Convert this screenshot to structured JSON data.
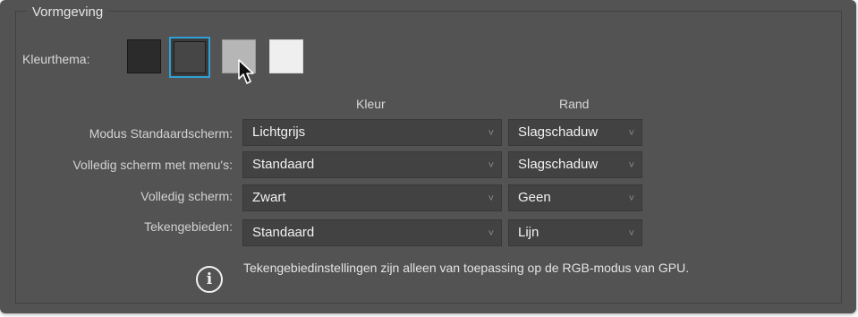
{
  "section": {
    "title": "Vormgeving"
  },
  "theme": {
    "label": "Kleurthema:",
    "swatches": [
      {
        "name": "dark",
        "color": "#2b2b2b"
      },
      {
        "name": "medium-dark",
        "color": "#3b3b3b",
        "selected": true
      },
      {
        "name": "medium-light",
        "color": "#b6b6b6"
      },
      {
        "name": "light",
        "color": "#efefef"
      }
    ],
    "selected_border_color": "#30a1d6"
  },
  "columns": {
    "kleur": "Kleur",
    "rand": "Rand"
  },
  "rows": [
    {
      "label": "Modus Standaardscherm:",
      "kleur": "Lichtgrijs",
      "rand": "Slagschaduw"
    },
    {
      "label": "Volledig scherm met menu's:",
      "kleur": "Standaard",
      "rand": "Slagschaduw"
    },
    {
      "label": "Volledig scherm:",
      "kleur": "Zwart",
      "rand": "Geen"
    },
    {
      "label": "Tekengebieden:",
      "kleur": "Standaard",
      "rand": "Lijn"
    }
  ],
  "info": {
    "icon": "info-icon",
    "glyph": "i",
    "text": "Tekengebiedinstellingen zijn alleen van toepassing op de RGB-modus van GPU."
  },
  "icons": {
    "chevron": "˅"
  }
}
